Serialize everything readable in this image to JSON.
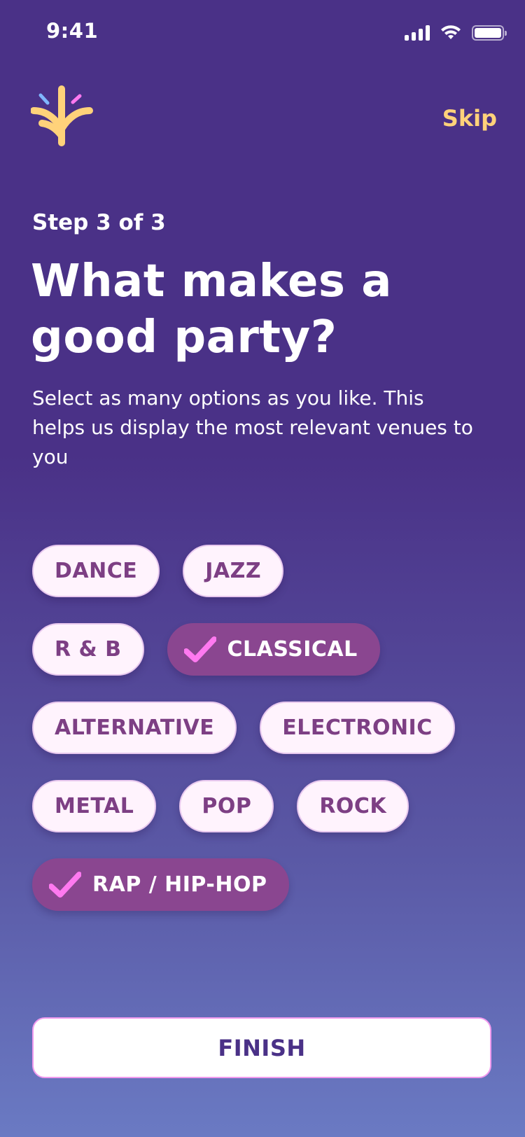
{
  "status_bar": {
    "time": "9:41"
  },
  "header": {
    "skip_label": "Skip"
  },
  "onboarding": {
    "step_label": "Step 3 of 3",
    "title": "What makes a good party?",
    "subtitle": "Select as many options as you like. This helps us display the most relevant venues to you"
  },
  "genres": [
    {
      "label": "DANCE",
      "selected": false
    },
    {
      "label": "JAZZ",
      "selected": false
    },
    {
      "label": "R & B",
      "selected": false
    },
    {
      "label": "CLASSICAL",
      "selected": true
    },
    {
      "label": "ALTERNATIVE",
      "selected": false
    },
    {
      "label": "ELECTRONIC",
      "selected": false
    },
    {
      "label": "METAL",
      "selected": false
    },
    {
      "label": "POP",
      "selected": false
    },
    {
      "label": "ROCK",
      "selected": false
    },
    {
      "label": "RAP / HIP-HOP",
      "selected": true
    }
  ],
  "footer": {
    "finish_label": "FINISH"
  },
  "colors": {
    "background_top": "#4a3187",
    "background_bottom": "#6a7ac3",
    "accent": "#ffd27a",
    "chip_text": "#7d3f84",
    "chip_selected": "#8a4690",
    "check": "#ff79f0"
  },
  "icons": {
    "logo": "sparkle-logo-icon",
    "check": "check-icon",
    "signal": "cellular-signal-icon",
    "wifi": "wifi-icon",
    "battery": "battery-icon"
  }
}
